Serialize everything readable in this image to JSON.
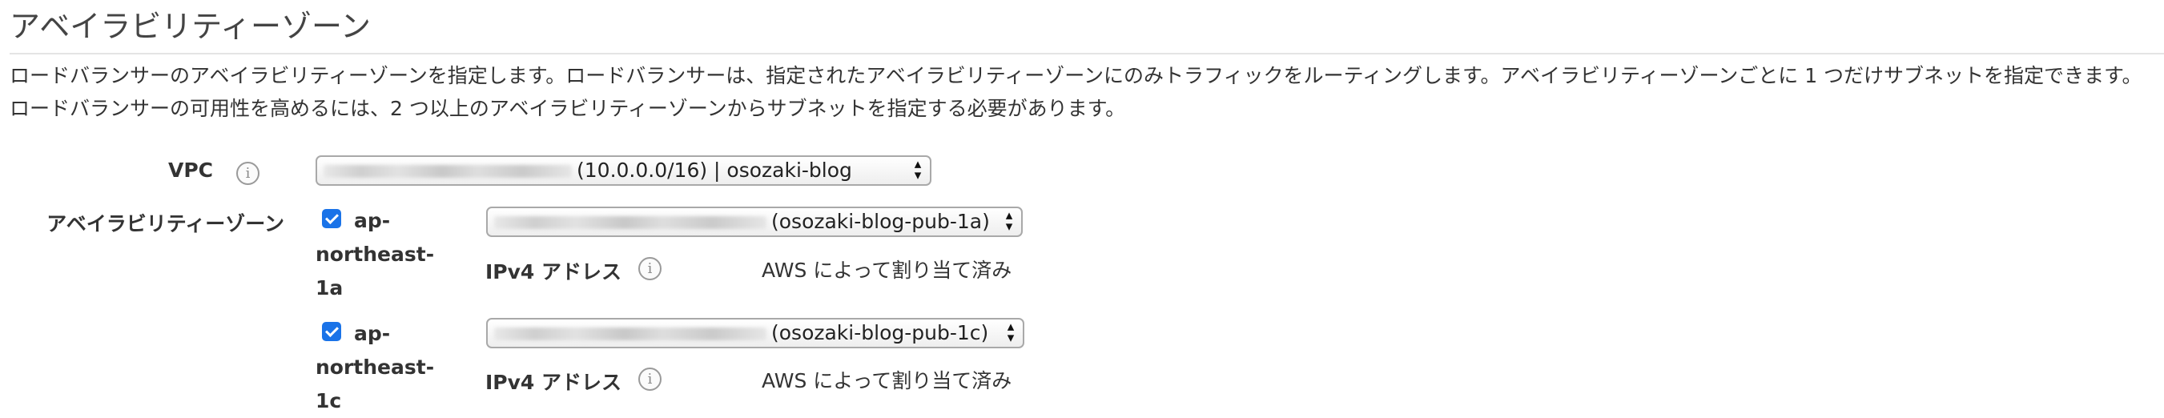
{
  "section": {
    "title": "アベイラビリティーゾーン",
    "description": "ロードバランサーのアベイラビリティーゾーンを指定します。ロードバランサーは、指定されたアベイラビリティーゾーンにのみトラフィックをルーティングします。アベイラビリティーゾーンごとに 1 つだけサブネットを指定できます。ロードバランサーの可用性を高めるには、2 つ以上のアベイラビリティーゾーンからサブネットを指定する必要があります。"
  },
  "vpc": {
    "label": "VPC",
    "selected_value": "(10.0.0.0/16) | osozaki-blog",
    "info_icon": "i"
  },
  "availability_zones": {
    "label": "アベイラビリティーゾーン",
    "zones": [
      {
        "checked": true,
        "name": "ap-northeast-1a",
        "subnet_value": "(osozaki-blog-pub-1a)",
        "ipv4_label": "IPv4 アドレス",
        "ipv4_value": "AWS によって割り当て済み"
      },
      {
        "checked": true,
        "name": "ap-northeast-1c",
        "subnet_value": "(osozaki-blog-pub-1c)",
        "ipv4_label": "IPv4 アドレス",
        "ipv4_value": "AWS によって割り当て済み"
      }
    ]
  },
  "icons": {
    "info": "info-icon",
    "select_caret": "chevron-up-down-icon",
    "checkbox": "checkbox-checked-icon"
  },
  "colors": {
    "checkbox_accent": "#1a73e8",
    "text": "#333333",
    "rule": "#e4e4e4"
  }
}
